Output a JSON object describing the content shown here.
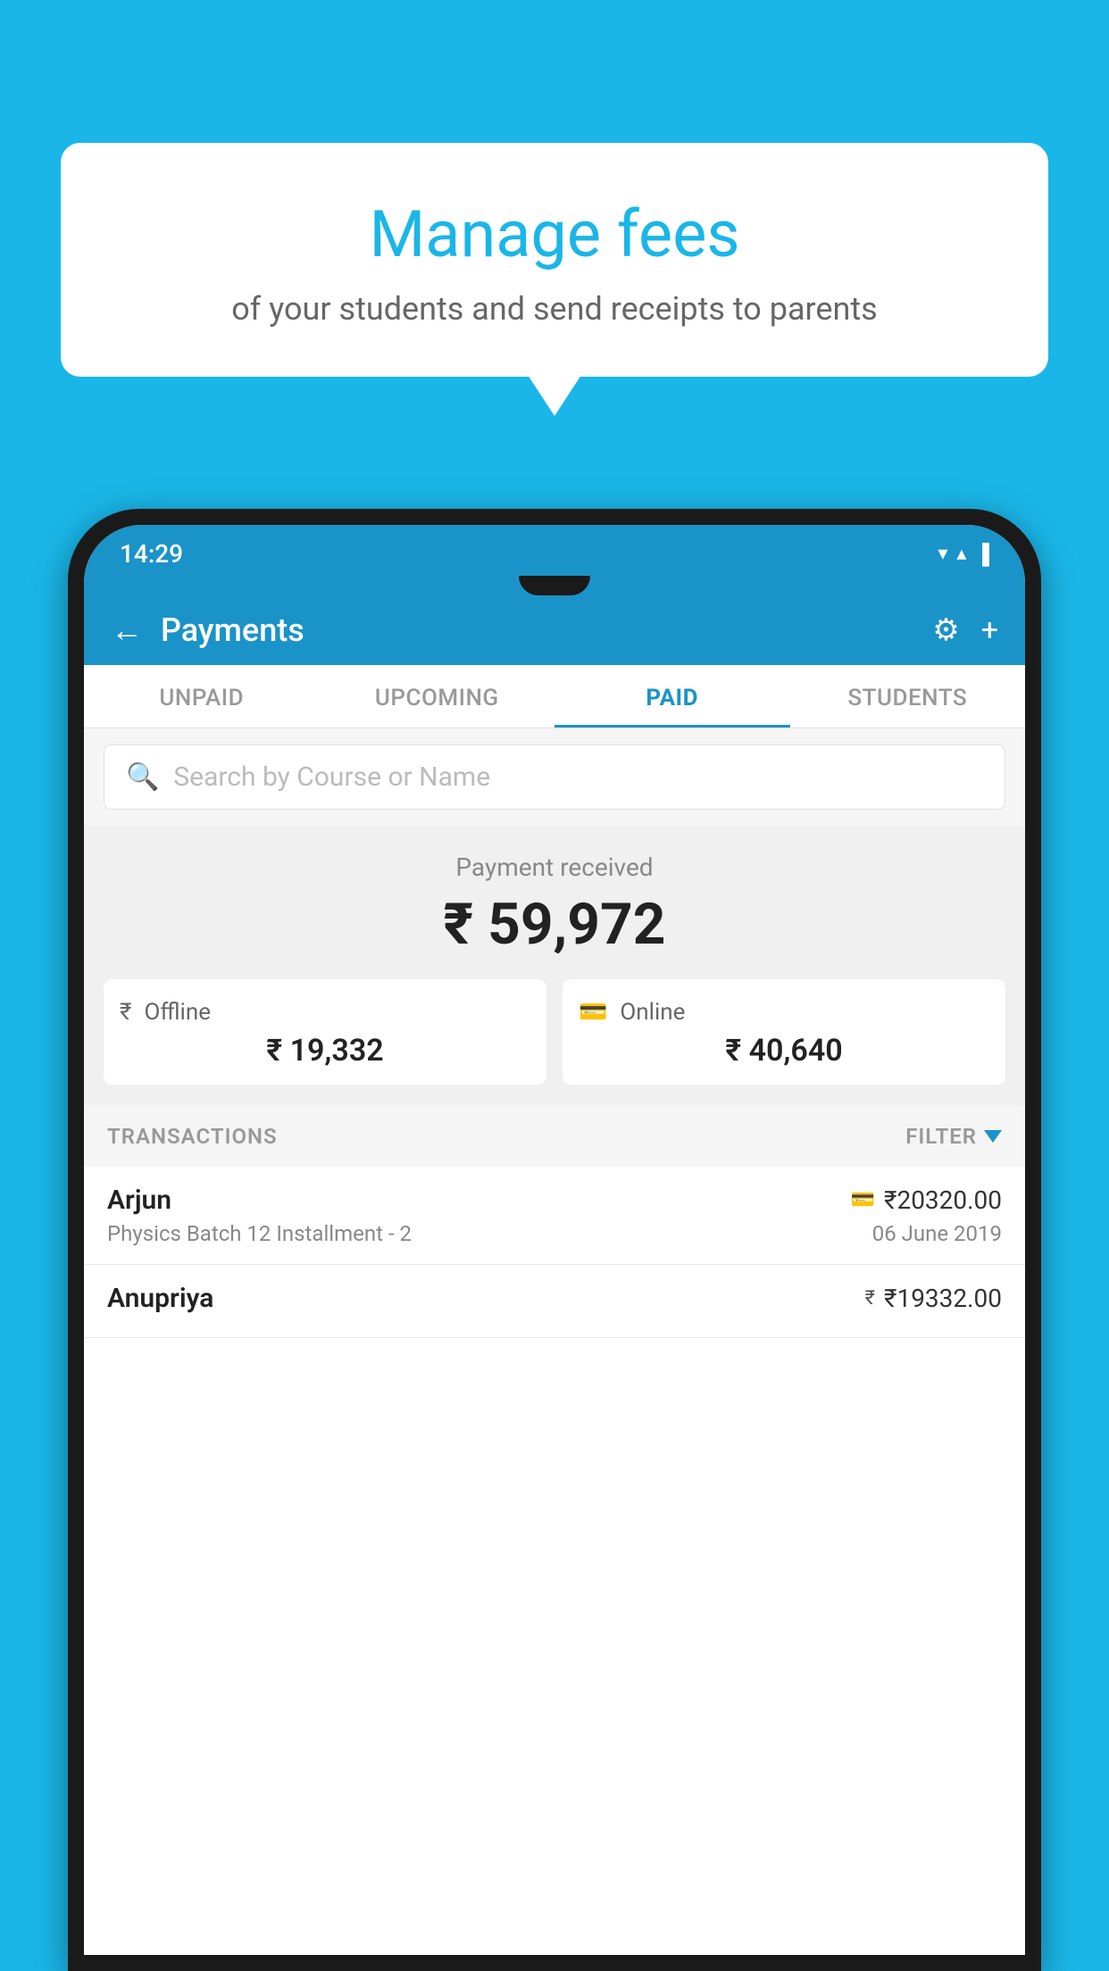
{
  "background_color": "#1ab6e8",
  "bubble": {
    "title": "Manage fees",
    "subtitle": "of your students and send receipts to parents"
  },
  "status_bar": {
    "time": "14:29",
    "wifi_icon": "▼",
    "signal_icon": "▲",
    "battery_icon": "▐"
  },
  "app_bar": {
    "back_label": "←",
    "title": "Payments",
    "gear_label": "⚙",
    "plus_label": "+"
  },
  "tabs": [
    {
      "label": "UNPAID",
      "active": false
    },
    {
      "label": "UPCOMING",
      "active": false
    },
    {
      "label": "PAID",
      "active": true
    },
    {
      "label": "STUDENTS",
      "active": false
    }
  ],
  "search": {
    "placeholder": "Search by Course or Name"
  },
  "payment_summary": {
    "label": "Payment received",
    "amount": "₹ 59,972",
    "offline": {
      "label": "Offline",
      "amount": "₹ 19,332"
    },
    "online": {
      "label": "Online",
      "amount": "₹ 40,640"
    }
  },
  "transactions": {
    "header_label": "TRANSACTIONS",
    "filter_label": "FILTER",
    "items": [
      {
        "name": "Arjun",
        "amount": "₹20320.00",
        "description": "Physics Batch 12 Installment - 2",
        "date": "06 June 2019",
        "payment_type": "card"
      },
      {
        "name": "Anupriya",
        "amount": "₹19332.00",
        "description": "",
        "date": "",
        "payment_type": "cash"
      }
    ]
  }
}
